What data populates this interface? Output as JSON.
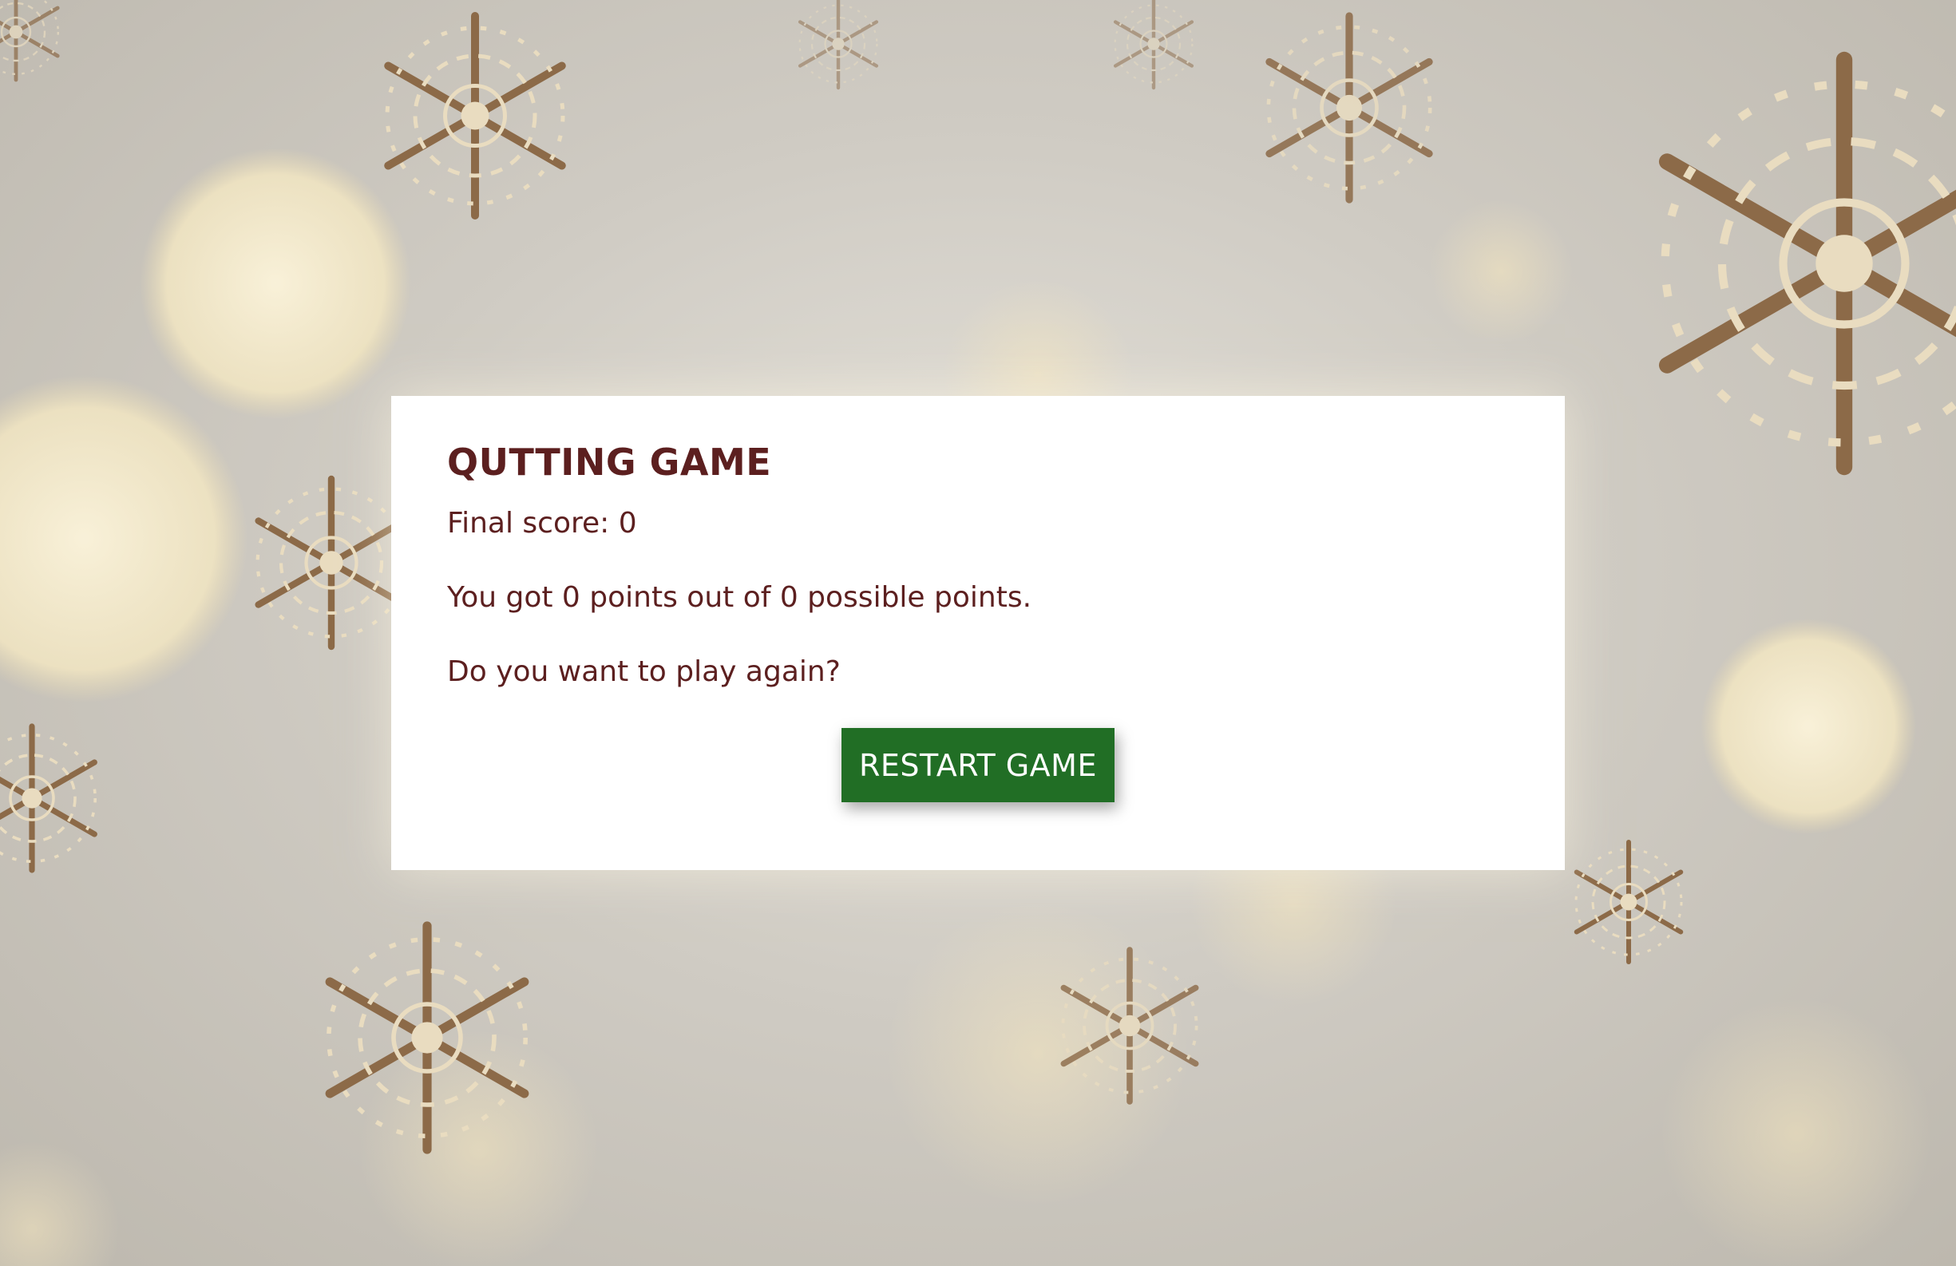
{
  "background": {
    "image": "snowflakes-bokeh-icon",
    "colors": {
      "base": "#cfcbc3",
      "cream": "#f5ecd0",
      "tan": "#9a7a58"
    }
  },
  "modal": {
    "title": "QUTTING GAME",
    "final_score": "Final score: 0",
    "result": "You got 0 points out of 0 possible points.",
    "question": "Do you want to play again?",
    "restart_label": "RESTART GAME"
  },
  "colors": {
    "text": "#5c1f1f",
    "button": "#216e25",
    "button_text": "#ffffff",
    "card": "#ffffff"
  }
}
